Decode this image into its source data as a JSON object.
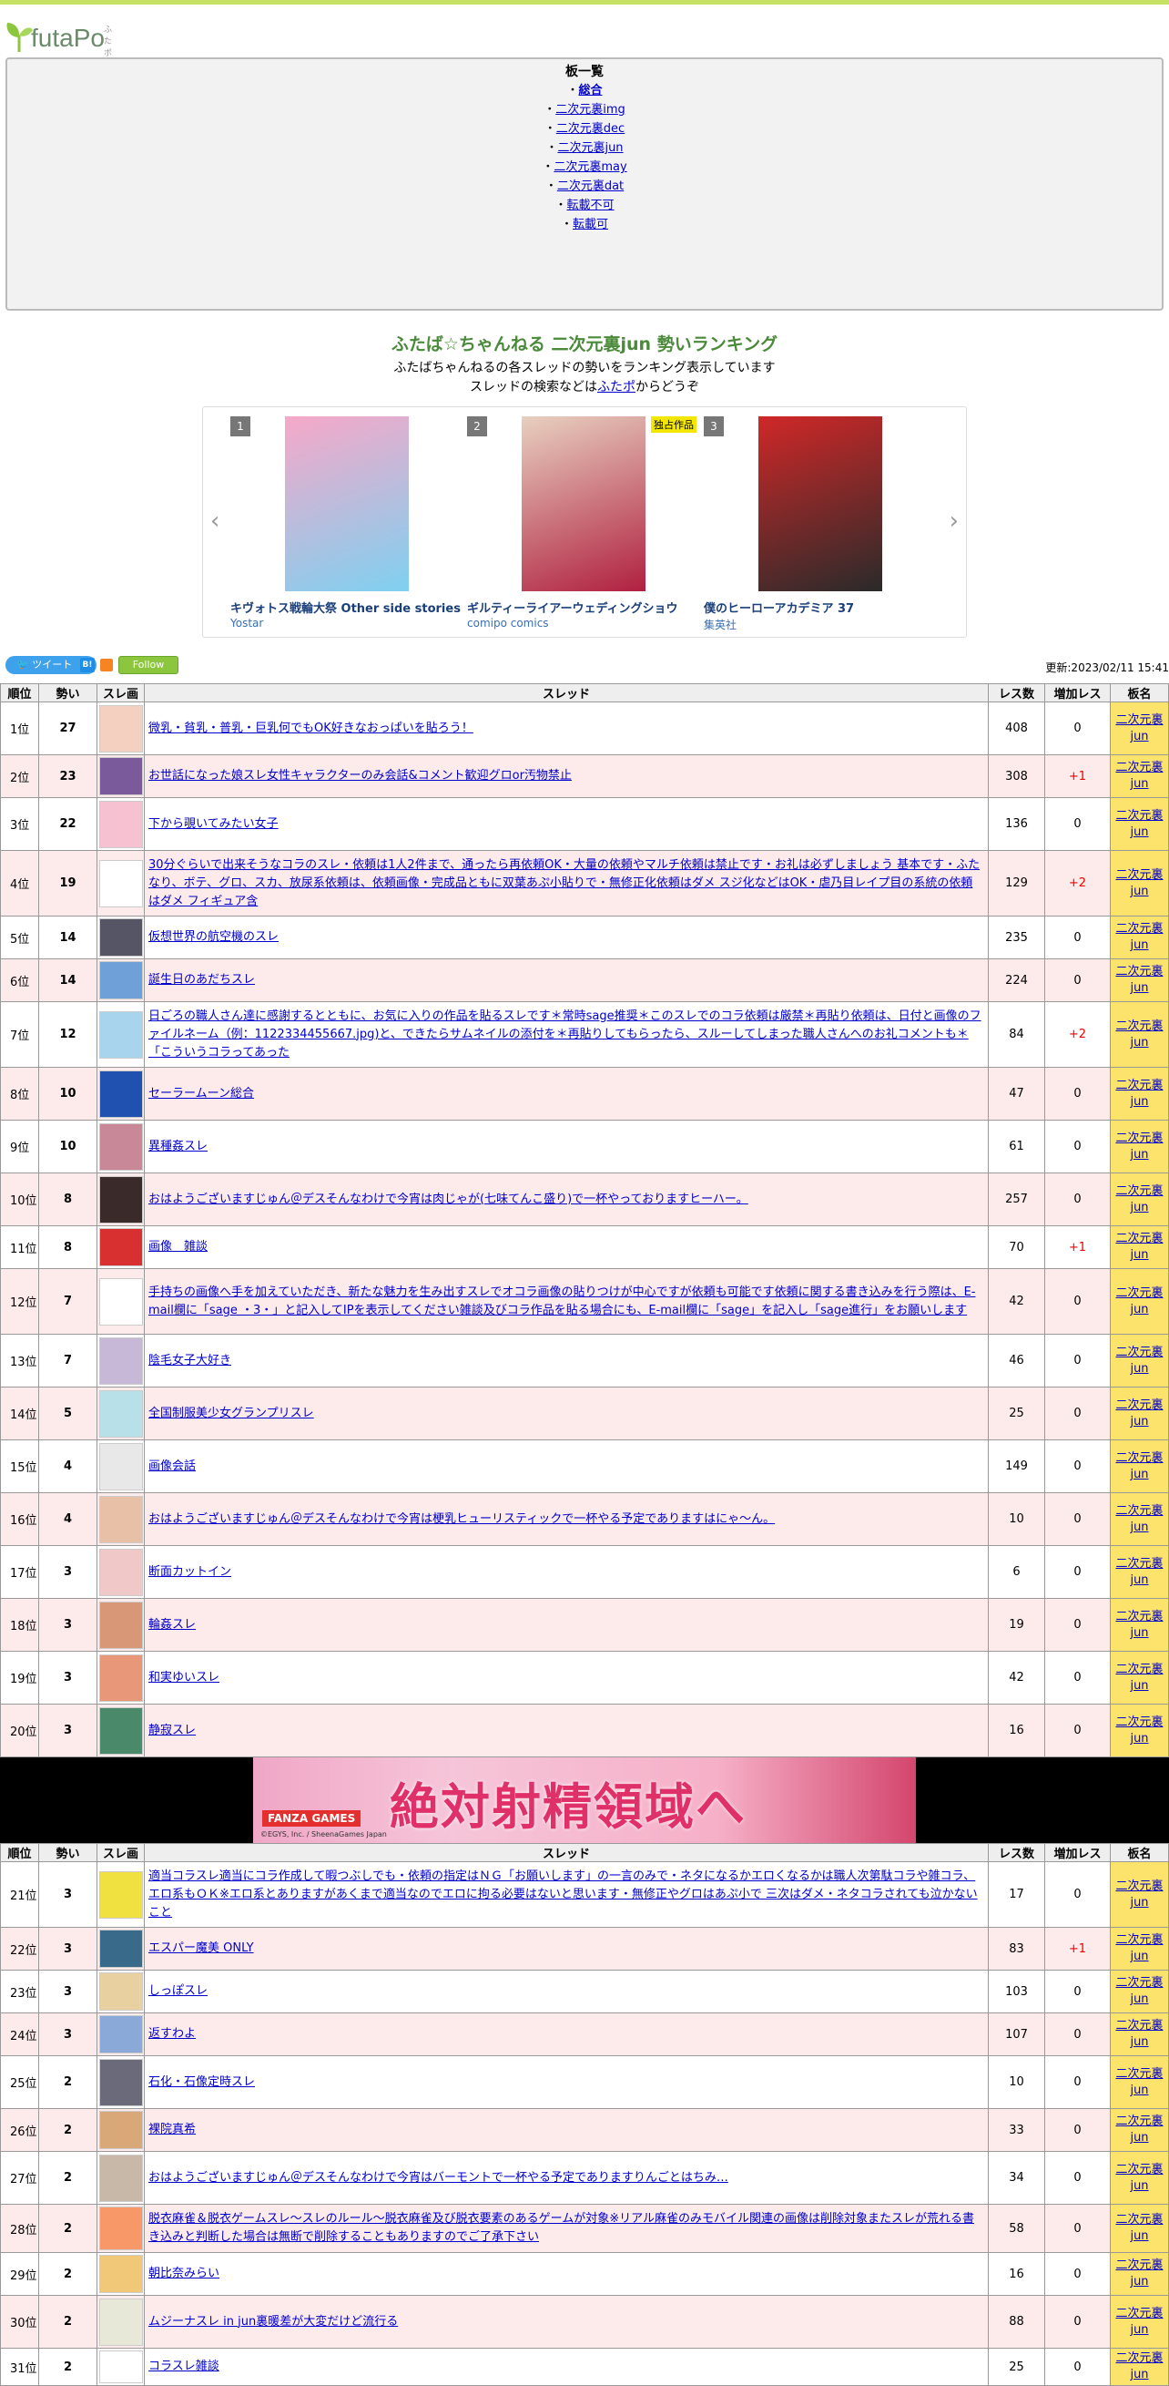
{
  "header": {
    "logo_text": "futaPo",
    "logo_sup": "ふたポ"
  },
  "boards": {
    "title": "板一覧",
    "items": [
      {
        "prefix": "・",
        "label": "総合",
        "bold": true
      },
      {
        "prefix": "・",
        "label": "二次元裏img"
      },
      {
        "prefix": "・",
        "label": "二次元裏dec"
      },
      {
        "prefix": "・",
        "label": "二次元裏jun"
      },
      {
        "prefix": "・",
        "label": "二次元裏may"
      },
      {
        "prefix": "・",
        "label": "二次元裏dat"
      },
      {
        "prefix": "・",
        "label": "転載不可"
      },
      {
        "prefix": "・",
        "label": "転載可"
      }
    ]
  },
  "ranking": {
    "title": "ふたば☆ちゃんねる 二次元裏jun 勢いランキング",
    "desc1": "ふたばちゃんねるの各スレッドの勢いをランキング表示しています",
    "desc2_pre": "スレッドの検索などは",
    "desc2_link": "ふたポ",
    "desc2_post": "からどうぞ"
  },
  "carousel": {
    "prev": "‹",
    "next": "›",
    "items": [
      {
        "num": "1",
        "title": "キヴォトス戦輪大祭 Other side stories",
        "publisher": "Yostar",
        "color1": "#f7a8c8",
        "color2": "#7fd0f0",
        "badge": ""
      },
      {
        "num": "2",
        "title": "ギルティーライアーウェディングショウ",
        "publisher": "comipo comics",
        "color1": "#e8d0c0",
        "color2": "#b02040",
        "badge": "独占作品"
      },
      {
        "num": "3",
        "title": "僕のヒーローアカデミア 37",
        "publisher": "集英社",
        "color1": "#d02828",
        "color2": "#2a2a2a",
        "badge": ""
      }
    ]
  },
  "social": {
    "tweet": "ツイート",
    "hatena": "B!",
    "follow": "Follow",
    "updated": "更新:2023/02/11 15:41"
  },
  "table": {
    "headers": [
      "順位",
      "勢い",
      "スレ画",
      "スレッド",
      "レス数",
      "増加レス",
      "板名"
    ],
    "board_name_line1": "二次元裏",
    "board_name_line2": "jun"
  },
  "rows1": [
    {
      "rank": "1位",
      "mom": "27",
      "title": "微乳・貧乳・普乳・巨乳何でもOK好きなおっぱいを貼ろう！",
      "res": "408",
      "inc": "0",
      "h": 58,
      "thumb": "#f3d0c0"
    },
    {
      "rank": "2位",
      "mom": "23",
      "title": "お世話になった娘スレ女性キャラクターのみ会話&コメント歓迎グロor汚物禁止",
      "res": "308",
      "inc": "+1",
      "h": 46,
      "thumb": "#7a5a9a"
    },
    {
      "rank": "3位",
      "mom": "22",
      "title": "下から覗いてみたい女子",
      "res": "136",
      "inc": "0",
      "h": 58,
      "thumb": "#f6c2d2"
    },
    {
      "rank": "4位",
      "mom": "19",
      "title": "30分ぐらいで出来そうなコラのスレ・依頼は1人2件まで、通ったら再依頼OK・大量の依頼やマルチ依頼は禁止です・お礼は必ずしましょう 基本です・ふたなり、ボテ、グロ、スカ、放尿系依頼は、依頼画像・完成品ともに双葉あぷ小貼りで・無修正化依頼はダメ スジ化などはOK・虐乃目レイプ目の系統の依頼はダメ フィギュア含",
      "res": "129",
      "inc": "+2",
      "h": 72,
      "thumb": "#ffffff"
    },
    {
      "rank": "5位",
      "mom": "14",
      "title": "仮想世界の航空機のスレ",
      "res": "235",
      "inc": "0",
      "h": 46,
      "thumb": "#555566"
    },
    {
      "rank": "6位",
      "mom": "14",
      "title": "誕生日のあだちスレ",
      "res": "224",
      "inc": "0",
      "h": 46,
      "thumb": "#6fa0d8"
    },
    {
      "rank": "7位",
      "mom": "12",
      "title": "日ごろの職人さん達に感謝するとともに、お気に入りの作品を貼るスレです＊常時sage推奨＊このスレでのコラ依頼は厳禁＊再貼り依頼は、日付と画像のファイルネーム（例：1122334455667.jpg)と、できたらサムネイルの添付を＊再貼りしてもらったら、スルーしてしまった職人さんへのお礼コメントも＊「こういうコラってあった",
      "res": "84",
      "inc": "+2",
      "h": 72,
      "thumb": "#a8d4ee"
    },
    {
      "rank": "8位",
      "mom": "10",
      "title": "セーラームーン総合",
      "res": "47",
      "inc": "0",
      "h": 58,
      "thumb": "#2050b0"
    },
    {
      "rank": "9位",
      "mom": "10",
      "title": "異種姦スレ",
      "res": "61",
      "inc": "0",
      "h": 58,
      "thumb": "#c88898"
    },
    {
      "rank": "10位",
      "mom": "8",
      "title": "おはようございますじゅん＠デスそんなわけで今宵は肉じゃが(七味てんこ盛り)で一杯やっておりますヒーハー。",
      "res": "257",
      "inc": "0",
      "h": 58,
      "thumb": "#3a2a2a"
    },
    {
      "rank": "11位",
      "mom": "8",
      "title": "画像　雑談",
      "res": "70",
      "inc": "+1",
      "h": 46,
      "thumb": "#d83030"
    },
    {
      "rank": "12位",
      "mom": "7",
      "title": "手持ちの画像へ手を加えていただき、新たな魅力を生み出すスレでオコラ画像の貼りつけが中心ですが依頼も可能です依頼に関する書き込みを行う際は、E-mail欄に「sage ・3・」と記入してIPを表示してください雑談及びコラ作品を貼る場合にも、E-mail欄に「sage」を記入し「sage進行」をお願いします",
      "res": "42",
      "inc": "0",
      "h": 72,
      "thumb": "#ffffff"
    },
    {
      "rank": "13位",
      "mom": "7",
      "title": "陰毛女子大好き",
      "res": "46",
      "inc": "0",
      "h": 58,
      "thumb": "#c8b8d8"
    },
    {
      "rank": "14位",
      "mom": "5",
      "title": "全国制服美少女グランプリスレ",
      "res": "25",
      "inc": "0",
      "h": 58,
      "thumb": "#b8e0e8"
    },
    {
      "rank": "15位",
      "mom": "4",
      "title": "画像会話",
      "res": "149",
      "inc": "0",
      "h": 58,
      "thumb": "#e8e8e8"
    },
    {
      "rank": "16位",
      "mom": "4",
      "title": "おはようございますじゅん＠デスそんなわけで今宵は梗乳ヒューリスティックで一杯やる予定でありますはにゃ〜ん。",
      "res": "10",
      "inc": "0",
      "h": 58,
      "thumb": "#e8c0a8"
    },
    {
      "rank": "17位",
      "mom": "3",
      "title": "断面カットイン",
      "res": "6",
      "inc": "0",
      "h": 58,
      "thumb": "#f0c8c8"
    },
    {
      "rank": "18位",
      "mom": "3",
      "title": "輪姦スレ",
      "res": "19",
      "inc": "0",
      "h": 58,
      "thumb": "#d89878"
    },
    {
      "rank": "19位",
      "mom": "3",
      "title": "和実ゆいスレ",
      "res": "42",
      "inc": "0",
      "h": 58,
      "thumb": "#e89878"
    },
    {
      "rank": "20位",
      "mom": "3",
      "title": "静寂スレ",
      "res": "16",
      "inc": "0",
      "h": 58,
      "thumb": "#4a8a6a"
    }
  ],
  "banner": {
    "text": "絶対射精領域へ",
    "logo": "FANZA GAMES",
    "copy": "©EGYS, Inc. / SheenaGames Japan",
    "bg": "#000000"
  },
  "rows2": [
    {
      "rank": "21位",
      "mom": "3",
      "title": "適当コラスレ適当にコラ作成して暇つぶしでも・依頼の指定はＮＧ「お願いします」の一言のみで・ネタになるかエロくなるかは職人次第駄コラや雑コラ、エロ系もＯＫ※エロ系とありますがあくまで適当なのでエロに拘る必要はないと思います・無修正やグロはあぷ小で 三次はダメ・ネタコラされても泣かないこと",
      "res": "17",
      "inc": "0",
      "h": 72,
      "thumb": "#f0e040"
    },
    {
      "rank": "22位",
      "mom": "3",
      "title": "エスパー魔美 ONLY",
      "res": "83",
      "inc": "+1",
      "h": 46,
      "thumb": "#3a6a8a"
    },
    {
      "rank": "23位",
      "mom": "3",
      "title": "しっぽスレ",
      "res": "103",
      "inc": "0",
      "h": 46,
      "thumb": "#e8d0a0"
    },
    {
      "rank": "24位",
      "mom": "3",
      "title": "返すわよ",
      "res": "107",
      "inc": "0",
      "h": 46,
      "thumb": "#8aa8d8"
    },
    {
      "rank": "25位",
      "mom": "2",
      "title": "石化・石像定時スレ",
      "res": "10",
      "inc": "0",
      "h": 58,
      "thumb": "#6a6a7a"
    },
    {
      "rank": "26位",
      "mom": "2",
      "title": "裸院真希",
      "res": "33",
      "inc": "0",
      "h": 46,
      "thumb": "#d8a878"
    },
    {
      "rank": "27位",
      "mom": "2",
      "title": "おはようございますじゅん＠デスそんなわけで今宵はバーモントで一杯やる予定でありますりんごとはちみ…",
      "res": "34",
      "inc": "0",
      "h": 58,
      "thumb": "#c8b8a8"
    },
    {
      "rank": "28位",
      "mom": "2",
      "title": "脱衣麻雀＆脱衣ゲームスレ〜スレのルール〜脱衣麻雀及び脱衣要素のあるゲームが対象※リアル麻雀のみモバイル関連の画像は削除対象またスレが荒れる書き込みと判断した場合は無断で削除することもありますのでご了承下さい",
      "res": "58",
      "inc": "0",
      "h": 52,
      "thumb": "#f89868"
    },
    {
      "rank": "29位",
      "mom": "2",
      "title": "朝比奈みらい",
      "res": "16",
      "inc": "0",
      "h": 46,
      "thumb": "#f0c878"
    },
    {
      "rank": "30位",
      "mom": "2",
      "title": "ムジーナスレ in jun裏暖差が大変だけど流行る",
      "res": "88",
      "inc": "0",
      "h": 58,
      "thumb": "#e8e8d8"
    },
    {
      "rank": "31位",
      "mom": "2",
      "title": "コラスレ雑談",
      "res": "25",
      "inc": "0",
      "h": 40,
      "thumb": "#ffffff"
    }
  ]
}
